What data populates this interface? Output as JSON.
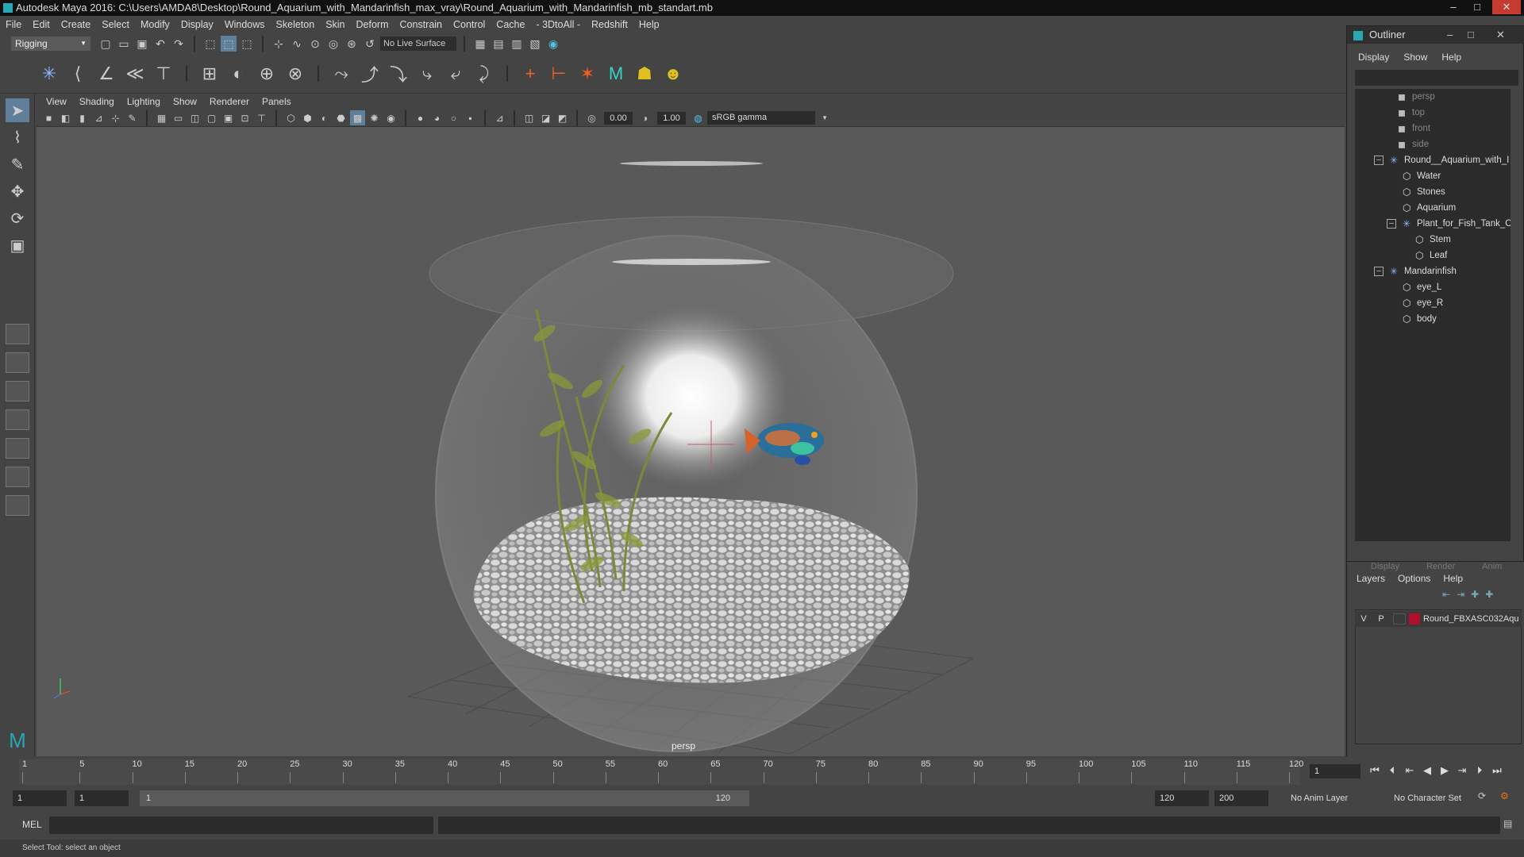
{
  "window": {
    "title": "Autodesk Maya 2016: C:\\Users\\AMDA8\\Desktop\\Round_Aquarium_with_Mandarinfish_max_vray\\Round_Aquarium_with_Mandarinfish_mb_standart.mb",
    "minimize": "–",
    "maximize": "□",
    "close": "✕"
  },
  "menubar": [
    "File",
    "Edit",
    "Create",
    "Select",
    "Modify",
    "Display",
    "Windows",
    "Skeleton",
    "Skin",
    "Deform",
    "Constrain",
    "Control",
    "Cache",
    "- 3DtoAll -",
    "Redshift",
    "Help"
  ],
  "statusline": {
    "mode": "Rigging",
    "live_surface": "No Live Surface"
  },
  "viewport": {
    "menu": [
      "View",
      "Shading",
      "Lighting",
      "Show",
      "Renderer",
      "Panels"
    ],
    "near_value": "0.00",
    "gamma_value": "1.00",
    "color_space": "sRGB gamma",
    "camera_label": "persp"
  },
  "outliner": {
    "title": "Outliner",
    "menu": [
      "Display",
      "Show",
      "Help"
    ],
    "items": [
      {
        "label": "persp",
        "type": "camera",
        "depth": 0
      },
      {
        "label": "top",
        "type": "camera",
        "depth": 0
      },
      {
        "label": "front",
        "type": "camera",
        "depth": 0
      },
      {
        "label": "side",
        "type": "camera",
        "depth": 0
      },
      {
        "label": "Round__Aquarium_with_I",
        "type": "group",
        "depth": 0
      },
      {
        "label": "Water",
        "type": "mesh",
        "depth": 1
      },
      {
        "label": "Stones",
        "type": "mesh",
        "depth": 1
      },
      {
        "label": "Aquarium",
        "type": "mesh",
        "depth": 1
      },
      {
        "label": "Plant_for_Fish_Tank_C",
        "type": "group",
        "depth": 1
      },
      {
        "label": "Stem",
        "type": "mesh",
        "depth": 2
      },
      {
        "label": "Leaf",
        "type": "mesh",
        "depth": 2
      },
      {
        "label": "Mandarinfish",
        "type": "group",
        "depth": 0
      },
      {
        "label": "eye_L",
        "type": "mesh",
        "depth": 1
      },
      {
        "label": "eye_R",
        "type": "mesh",
        "depth": 1
      },
      {
        "label": "body",
        "type": "mesh",
        "depth": 1
      }
    ]
  },
  "layers": {
    "tabs": [
      "Display",
      "Render",
      "Anim"
    ],
    "menu": [
      "Layers",
      "Options",
      "Help"
    ],
    "row": {
      "visible": "V",
      "playback": "P",
      "name": "Round_FBXASC032Aqu",
      "color": "#b0102a"
    }
  },
  "timeline": {
    "ticks": [
      "1",
      "5",
      "10",
      "15",
      "20",
      "25",
      "30",
      "35",
      "40",
      "45",
      "50",
      "55",
      "60",
      "65",
      "70",
      "75",
      "80",
      "85",
      "90",
      "95",
      "100",
      "105",
      "110",
      "115",
      "120"
    ],
    "current_frame": "1",
    "start_time": "1",
    "playback_start": "1",
    "slider_start": "1",
    "slider_end": "120",
    "playback_end": "120",
    "end_time": "200",
    "anim_layer": "No Anim Layer",
    "character_set": "No Character Set"
  },
  "command_line": {
    "label": "MEL"
  },
  "help_line": "Select Tool: select an object",
  "colors": {
    "accent": "#2aa7b5",
    "viewport_bg": "#595959",
    "panel_bg": "#444444"
  }
}
